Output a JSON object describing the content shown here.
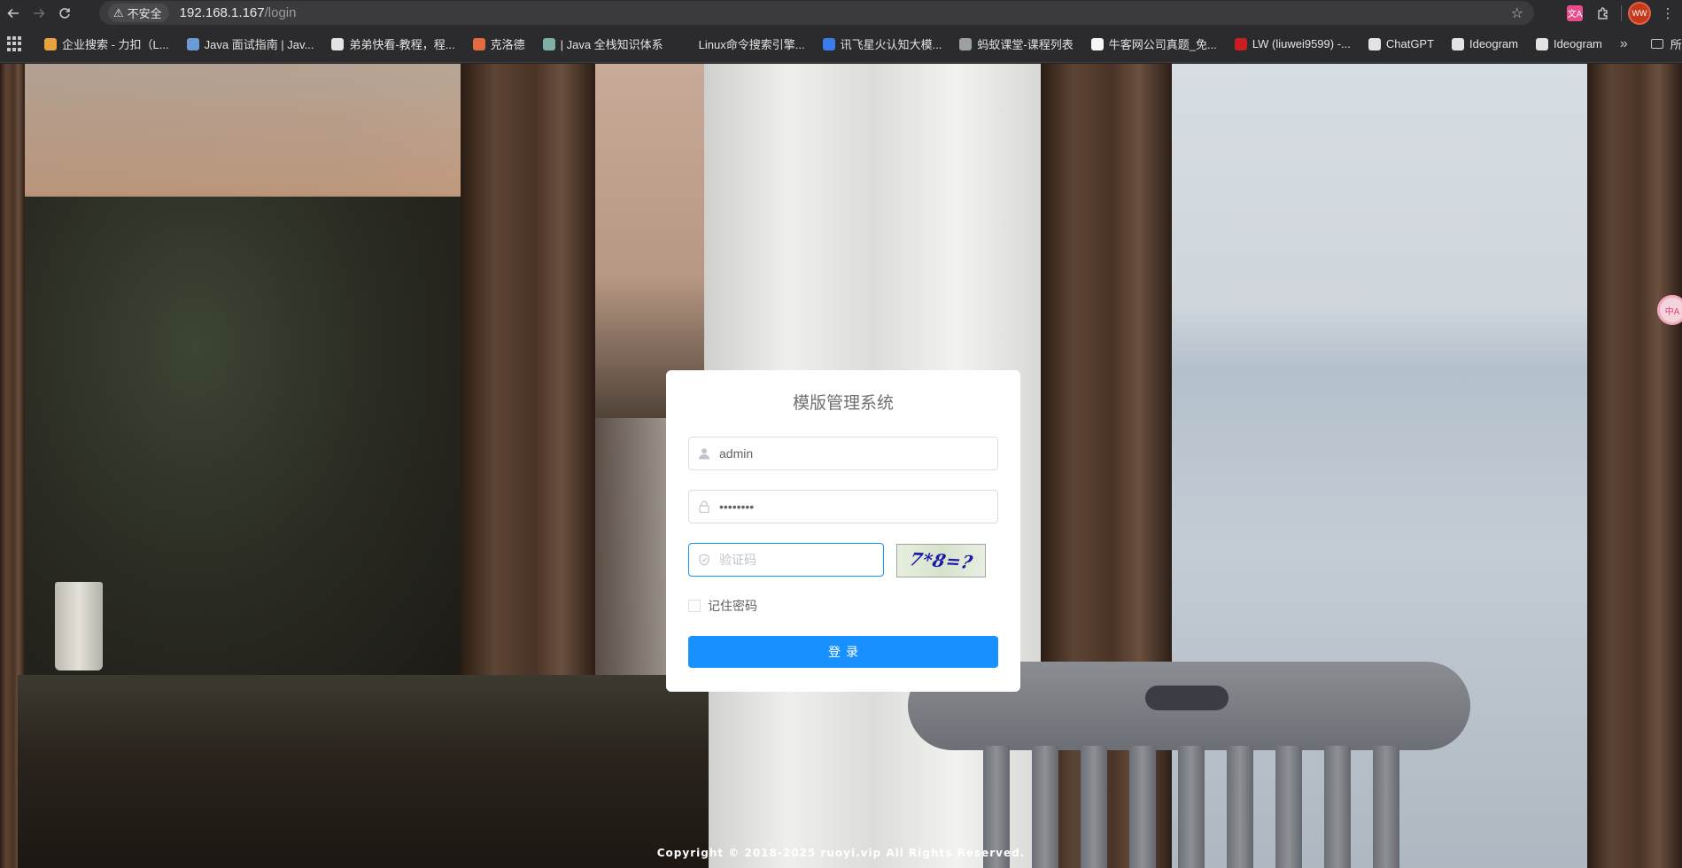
{
  "browser": {
    "security_label": "不安全",
    "url_host": "192.168.1.167",
    "url_path": "/login",
    "profile_initials": "WW",
    "translate_ext_label": "文A"
  },
  "bookmarks": {
    "items": [
      {
        "label": "企业搜索 - 力扣（L...",
        "icon": "leetcode-icon",
        "color": "#e8a33d"
      },
      {
        "label": "Java 面试指南 | Jav...",
        "icon": "feather-icon",
        "color": "#6a9bd8"
      },
      {
        "label": "弟弟快看-教程，程...",
        "icon": "layers-icon",
        "color": "#e3e3e3"
      },
      {
        "label": "克洛德",
        "icon": "sparkle-icon",
        "color": "#e26b3f"
      },
      {
        "label": "| Java 全栈知识体系",
        "icon": "image-icon",
        "color": "#7fb0a8"
      },
      {
        "label": "Linux命令搜索引擎...",
        "icon": "blank-icon",
        "color": "#2b2b2d"
      },
      {
        "label": "讯飞星火认知大模...",
        "icon": "spark-icon",
        "color": "#3a7bf0"
      },
      {
        "label": "蚂蚁课堂-课程列表",
        "icon": "globe-icon",
        "color": "#9aa0a6"
      },
      {
        "label": "牛客网公司真题_免...",
        "icon": "nowcoder-icon",
        "color": "#f5f5f5"
      },
      {
        "label": "LW (liuwei9599) -...",
        "icon": "gitee-icon",
        "color": "#c71d23"
      },
      {
        "label": "ChatGPT",
        "icon": "openai-icon",
        "color": "#e3e3e3"
      },
      {
        "label": "Ideogram",
        "icon": "ideogram-icon",
        "color": "#e3e3e3"
      },
      {
        "label": "Ideogram",
        "icon": "ideogram-icon",
        "color": "#e3e3e3"
      }
    ],
    "more_label": "»",
    "folder_label": "所有书签"
  },
  "login": {
    "title": "模版管理系统",
    "username_value": "admin",
    "password_value": "••••••••",
    "captcha_placeholder": "验证码",
    "captcha_image_text": "7*8=?",
    "remember_label": "记住密码",
    "submit_label": "登录"
  },
  "footer": {
    "copyright": "Copyright © 2018-2025 ruoyi.vip All Rights Reserved."
  },
  "side_badge_label": "中A",
  "colors": {
    "accent": "#1890ff",
    "captcha_text": "#1a1aa8"
  }
}
